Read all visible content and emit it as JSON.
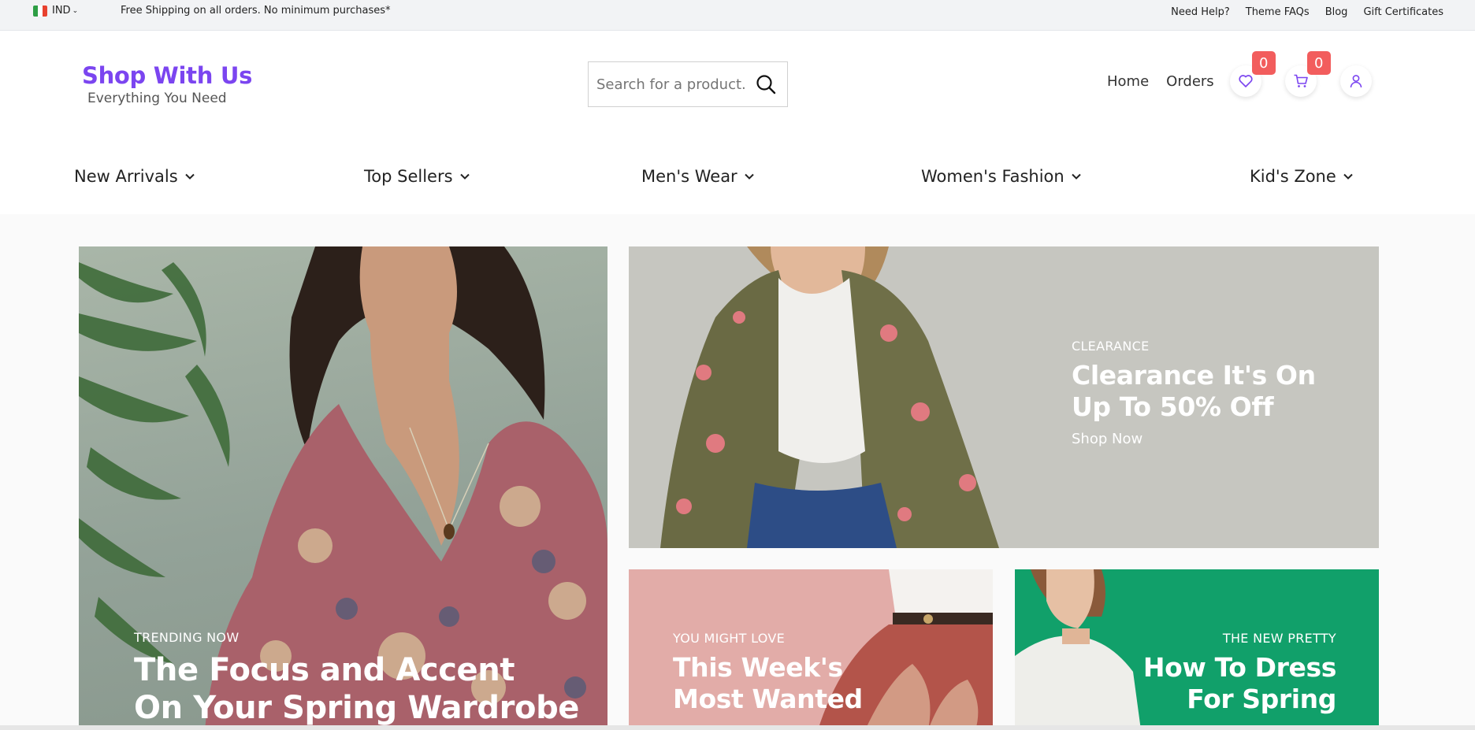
{
  "topbar": {
    "currency": "IND",
    "promo": "Free Shipping on all orders. No minimum purchases*",
    "links": [
      "Need Help?",
      "Theme FAQs",
      "Blog",
      "Gift Certificates"
    ]
  },
  "header": {
    "logo_title": "Shop With Us",
    "logo_tagline": "Everything You Need",
    "search_placeholder": "Search for a product...",
    "nav_links": [
      "Home",
      "Orders"
    ],
    "wishlist_count": "0",
    "cart_count": "0"
  },
  "main_nav": [
    "New Arrivals",
    "Top Sellers",
    "Men's Wear",
    "Women's Fashion",
    "Kid's Zone"
  ],
  "banners": {
    "trending": {
      "kicker": "TRENDING NOW",
      "line1": "The Focus and Accent",
      "line2": "On Your Spring Wardrobe"
    },
    "clearance": {
      "kicker": "CLEARANCE",
      "line1": "Clearance It's On",
      "line2": "Up To 50% Off",
      "cta": "Shop Now"
    },
    "love": {
      "kicker": "YOU MIGHT LOVE",
      "line1": "This Week's",
      "line2": "Most Wanted"
    },
    "pretty": {
      "kicker": "THE NEW PRETTY",
      "line1": "How To Dress",
      "line2": "For Spring"
    }
  },
  "colors": {
    "brand": "#7b45f0",
    "badge": "#f25d5d",
    "clearance_bg": "#c6c6c0",
    "love_bg": "#e2aca8",
    "pretty_bg": "#11a06a"
  }
}
